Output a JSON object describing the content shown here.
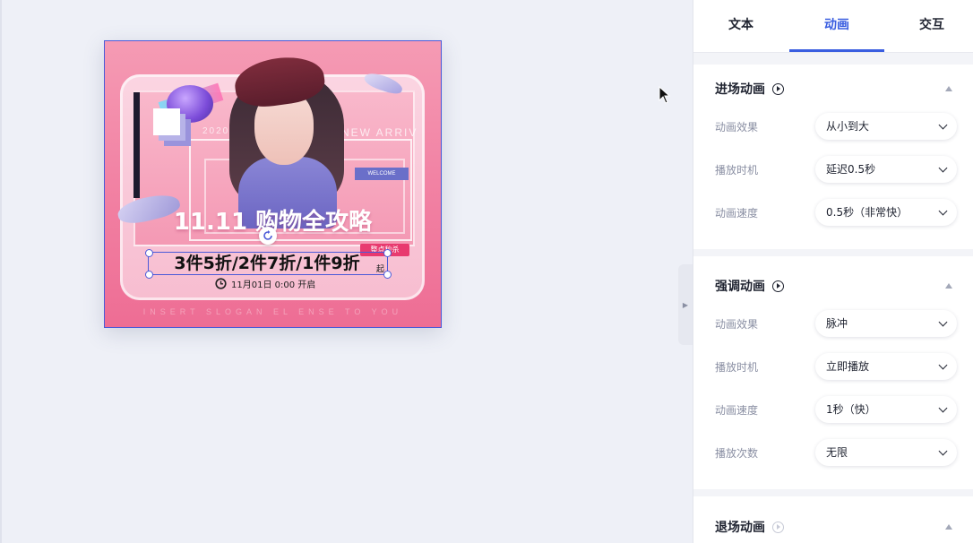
{
  "poster": {
    "bg_text_left": "2020",
    "bg_text_right": "NEW ARRIV",
    "welcome": "WELCOME",
    "headline": "11.11 购物全攻略",
    "tag": "整点秒杀",
    "promo": "3件5折/2件7折/1件9折",
    "promo_suffix": "起",
    "time_text": "11月01日 0:00 开启",
    "bottom_text": "INSERT SLOGAN EL ENSE TO YOU"
  },
  "tabs": [
    {
      "label": "文本"
    },
    {
      "label": "动画"
    },
    {
      "label": "交互"
    }
  ],
  "sections": {
    "entrance": {
      "title": "进场动画",
      "rows": [
        {
          "label": "动画效果",
          "value": "从小到大"
        },
        {
          "label": "播放时机",
          "value": "延迟0.5秒"
        },
        {
          "label": "动画速度",
          "value": "0.5秒（非常快）"
        }
      ]
    },
    "emphasis": {
      "title": "强调动画",
      "rows": [
        {
          "label": "动画效果",
          "value": "脉冲"
        },
        {
          "label": "播放时机",
          "value": "立即播放"
        },
        {
          "label": "动画速度",
          "value": "1秒（快）"
        },
        {
          "label": "播放次数",
          "value": "无限"
        }
      ]
    },
    "exit": {
      "title": "退场动画"
    }
  },
  "colors": {
    "accent": "#3a5ee0",
    "poster_pink": "#f284a5",
    "tag_red": "#e83a6f"
  }
}
